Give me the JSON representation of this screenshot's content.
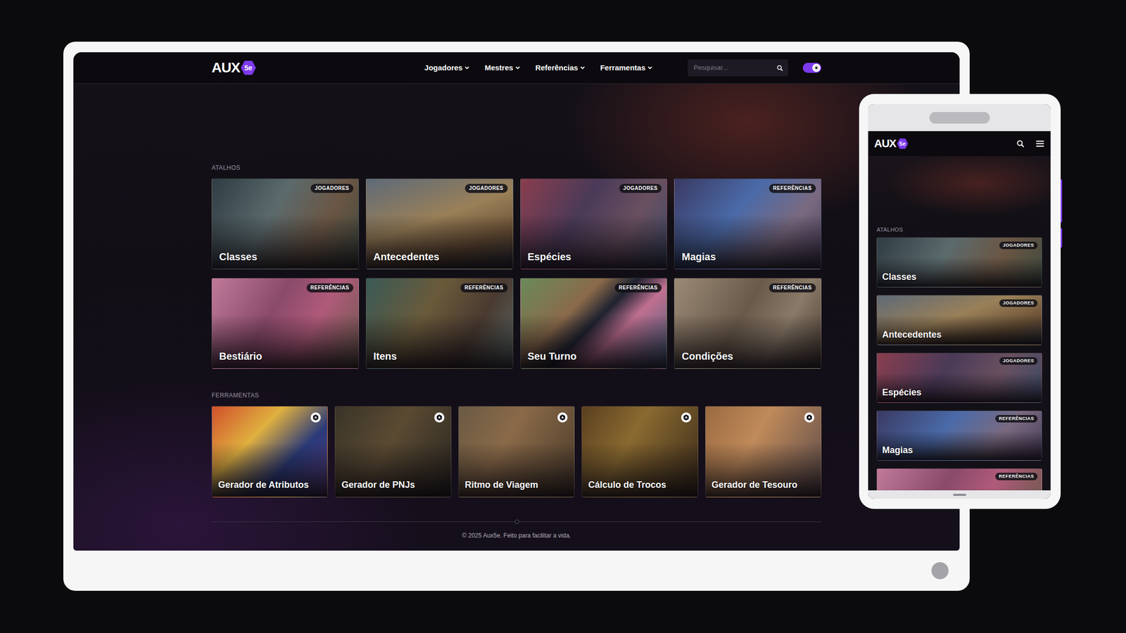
{
  "desktop": {
    "logo": {
      "text": "AUX",
      "badge": "5e"
    },
    "nav": [
      "Jogadores",
      "Mestres",
      "Referências",
      "Ferramentas"
    ],
    "search": {
      "placeholder": "Pesquisar..."
    },
    "theme_toggle": {
      "on": true
    },
    "shortcuts": {
      "title": "ATALHOS",
      "items": [
        {
          "title": "Classes",
          "tag": "JOGADORES"
        },
        {
          "title": "Antecedentes",
          "tag": "JOGADORES"
        },
        {
          "title": "Espécies",
          "tag": "JOGADORES"
        },
        {
          "title": "Magias",
          "tag": "REFERÊNCIAS"
        },
        {
          "title": "Bestiário",
          "tag": "REFERÊNCIAS"
        },
        {
          "title": "Itens",
          "tag": "REFERÊNCIAS"
        },
        {
          "title": "Seu Turno",
          "tag": "REFERÊNCIAS"
        },
        {
          "title": "Condições",
          "tag": "REFERÊNCIAS"
        }
      ]
    },
    "tools": {
      "title": "FERRAMENTAS",
      "items": [
        "Gerador de Atributos",
        "Gerador de PNJs",
        "Ritmo de Viagem",
        "Cálculo de Trocos",
        "Gerador de Tesouro"
      ]
    },
    "footer": "© 2025 Aux5e. Feito para facilitar a vida."
  },
  "mobile": {
    "logo": {
      "text": "AUX",
      "badge": "5e"
    },
    "shortcuts": {
      "title": "ATALHOS",
      "items": [
        {
          "title": "Classes",
          "tag": "JOGADORES"
        },
        {
          "title": "Antecedentes",
          "tag": "JOGADORES"
        },
        {
          "title": "Espécies",
          "tag": "JOGADORES"
        },
        {
          "title": "Magias",
          "tag": "REFERÊNCIAS"
        },
        {
          "tag": "REFERÊNCIAS"
        }
      ]
    }
  }
}
